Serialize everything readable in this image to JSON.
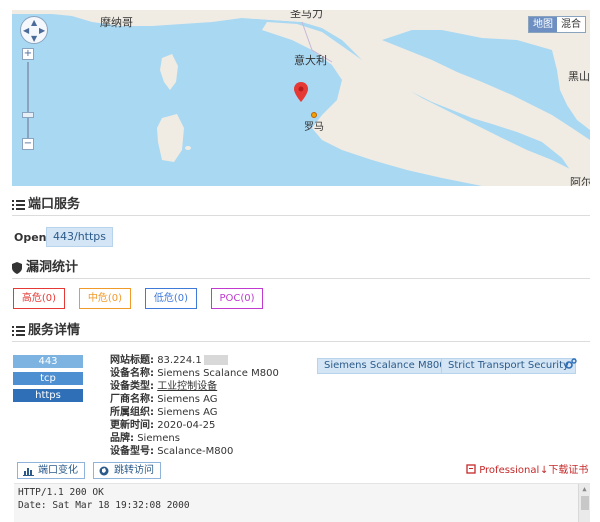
{
  "map": {
    "type_buttons": [
      "地图",
      "混合"
    ],
    "labels": {
      "monaco": "摩纳哥",
      "san_marino": "圣马力诺",
      "italy": "意大利",
      "rome": "罗马",
      "black_sea": "黑山",
      "albania": "阿尔",
      "marino_top": "圣马力"
    }
  },
  "ports_section": {
    "title": "端口服务",
    "open_label": "Open:",
    "ports": [
      "443/https"
    ]
  },
  "vuln_section": {
    "title": "漏洞统计",
    "badges": [
      {
        "label": "高危(0)",
        "color": "#e53935"
      },
      {
        "label": "中危(0)",
        "color": "#f09a2a"
      },
      {
        "label": "低危(0)",
        "color": "#3f7ad8"
      },
      {
        "label": "POC(0)",
        "color": "#c03ad0"
      }
    ]
  },
  "service_section": {
    "title": "服务详情",
    "port": "443",
    "transport": "tcp",
    "protocol": "https",
    "details": [
      {
        "key": "网站标题:",
        "value": "83.224.1"
      },
      {
        "key": "设备名称:",
        "value": "Siemens Scalance M800"
      },
      {
        "key": "设备类型:",
        "value": "工业控制设备"
      },
      {
        "key": "厂商名称:",
        "value": "Siemens AG"
      },
      {
        "key": "所属组织:",
        "value": "Siemens AG"
      },
      {
        "key": "更新时间:",
        "value": "2020-04-25"
      },
      {
        "key": "品牌:",
        "value": "Siemens"
      },
      {
        "key": "设备型号:",
        "value": "Scalance-M800"
      }
    ],
    "tags": [
      "Siemens Scalance M800",
      "Strict Transport Security"
    ],
    "buttons": {
      "port_change": "端口变化",
      "visit": "跳转访问"
    },
    "professional": "Professional",
    "download_cert": "下载证书",
    "console_lines": [
      "HTTP/1.1 200 OK",
      "Date: Sat Mar 18 19:32:08 2000"
    ]
  }
}
